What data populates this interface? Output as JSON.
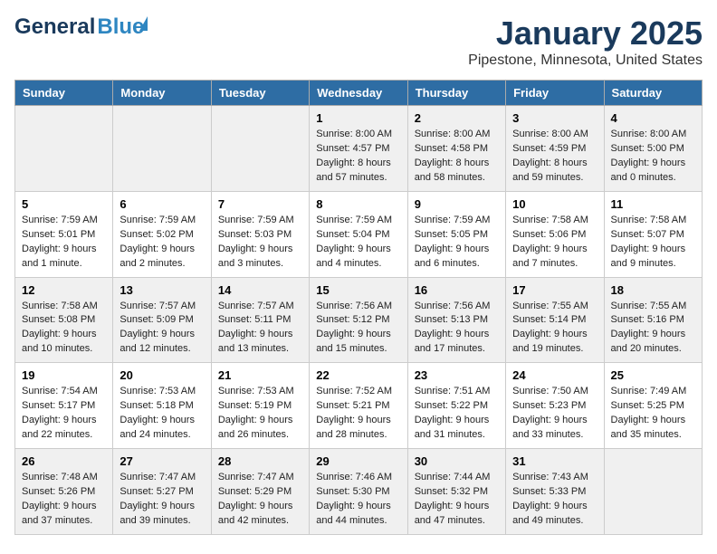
{
  "header": {
    "logo_general": "General",
    "logo_blue": "Blue",
    "month": "January 2025",
    "location": "Pipestone, Minnesota, United States"
  },
  "days_of_week": [
    "Sunday",
    "Monday",
    "Tuesday",
    "Wednesday",
    "Thursday",
    "Friday",
    "Saturday"
  ],
  "weeks": [
    [
      {
        "day": "",
        "info": ""
      },
      {
        "day": "",
        "info": ""
      },
      {
        "day": "",
        "info": ""
      },
      {
        "day": "1",
        "info": "Sunrise: 8:00 AM\nSunset: 4:57 PM\nDaylight: 8 hours and 57 minutes."
      },
      {
        "day": "2",
        "info": "Sunrise: 8:00 AM\nSunset: 4:58 PM\nDaylight: 8 hours and 58 minutes."
      },
      {
        "day": "3",
        "info": "Sunrise: 8:00 AM\nSunset: 4:59 PM\nDaylight: 8 hours and 59 minutes."
      },
      {
        "day": "4",
        "info": "Sunrise: 8:00 AM\nSunset: 5:00 PM\nDaylight: 9 hours and 0 minutes."
      }
    ],
    [
      {
        "day": "5",
        "info": "Sunrise: 7:59 AM\nSunset: 5:01 PM\nDaylight: 9 hours and 1 minute."
      },
      {
        "day": "6",
        "info": "Sunrise: 7:59 AM\nSunset: 5:02 PM\nDaylight: 9 hours and 2 minutes."
      },
      {
        "day": "7",
        "info": "Sunrise: 7:59 AM\nSunset: 5:03 PM\nDaylight: 9 hours and 3 minutes."
      },
      {
        "day": "8",
        "info": "Sunrise: 7:59 AM\nSunset: 5:04 PM\nDaylight: 9 hours and 4 minutes."
      },
      {
        "day": "9",
        "info": "Sunrise: 7:59 AM\nSunset: 5:05 PM\nDaylight: 9 hours and 6 minutes."
      },
      {
        "day": "10",
        "info": "Sunrise: 7:58 AM\nSunset: 5:06 PM\nDaylight: 9 hours and 7 minutes."
      },
      {
        "day": "11",
        "info": "Sunrise: 7:58 AM\nSunset: 5:07 PM\nDaylight: 9 hours and 9 minutes."
      }
    ],
    [
      {
        "day": "12",
        "info": "Sunrise: 7:58 AM\nSunset: 5:08 PM\nDaylight: 9 hours and 10 minutes."
      },
      {
        "day": "13",
        "info": "Sunrise: 7:57 AM\nSunset: 5:09 PM\nDaylight: 9 hours and 12 minutes."
      },
      {
        "day": "14",
        "info": "Sunrise: 7:57 AM\nSunset: 5:11 PM\nDaylight: 9 hours and 13 minutes."
      },
      {
        "day": "15",
        "info": "Sunrise: 7:56 AM\nSunset: 5:12 PM\nDaylight: 9 hours and 15 minutes."
      },
      {
        "day": "16",
        "info": "Sunrise: 7:56 AM\nSunset: 5:13 PM\nDaylight: 9 hours and 17 minutes."
      },
      {
        "day": "17",
        "info": "Sunrise: 7:55 AM\nSunset: 5:14 PM\nDaylight: 9 hours and 19 minutes."
      },
      {
        "day": "18",
        "info": "Sunrise: 7:55 AM\nSunset: 5:16 PM\nDaylight: 9 hours and 20 minutes."
      }
    ],
    [
      {
        "day": "19",
        "info": "Sunrise: 7:54 AM\nSunset: 5:17 PM\nDaylight: 9 hours and 22 minutes."
      },
      {
        "day": "20",
        "info": "Sunrise: 7:53 AM\nSunset: 5:18 PM\nDaylight: 9 hours and 24 minutes."
      },
      {
        "day": "21",
        "info": "Sunrise: 7:53 AM\nSunset: 5:19 PM\nDaylight: 9 hours and 26 minutes."
      },
      {
        "day": "22",
        "info": "Sunrise: 7:52 AM\nSunset: 5:21 PM\nDaylight: 9 hours and 28 minutes."
      },
      {
        "day": "23",
        "info": "Sunrise: 7:51 AM\nSunset: 5:22 PM\nDaylight: 9 hours and 31 minutes."
      },
      {
        "day": "24",
        "info": "Sunrise: 7:50 AM\nSunset: 5:23 PM\nDaylight: 9 hours and 33 minutes."
      },
      {
        "day": "25",
        "info": "Sunrise: 7:49 AM\nSunset: 5:25 PM\nDaylight: 9 hours and 35 minutes."
      }
    ],
    [
      {
        "day": "26",
        "info": "Sunrise: 7:48 AM\nSunset: 5:26 PM\nDaylight: 9 hours and 37 minutes."
      },
      {
        "day": "27",
        "info": "Sunrise: 7:47 AM\nSunset: 5:27 PM\nDaylight: 9 hours and 39 minutes."
      },
      {
        "day": "28",
        "info": "Sunrise: 7:47 AM\nSunset: 5:29 PM\nDaylight: 9 hours and 42 minutes."
      },
      {
        "day": "29",
        "info": "Sunrise: 7:46 AM\nSunset: 5:30 PM\nDaylight: 9 hours and 44 minutes."
      },
      {
        "day": "30",
        "info": "Sunrise: 7:44 AM\nSunset: 5:32 PM\nDaylight: 9 hours and 47 minutes."
      },
      {
        "day": "31",
        "info": "Sunrise: 7:43 AM\nSunset: 5:33 PM\nDaylight: 9 hours and 49 minutes."
      },
      {
        "day": "",
        "info": ""
      }
    ]
  ]
}
